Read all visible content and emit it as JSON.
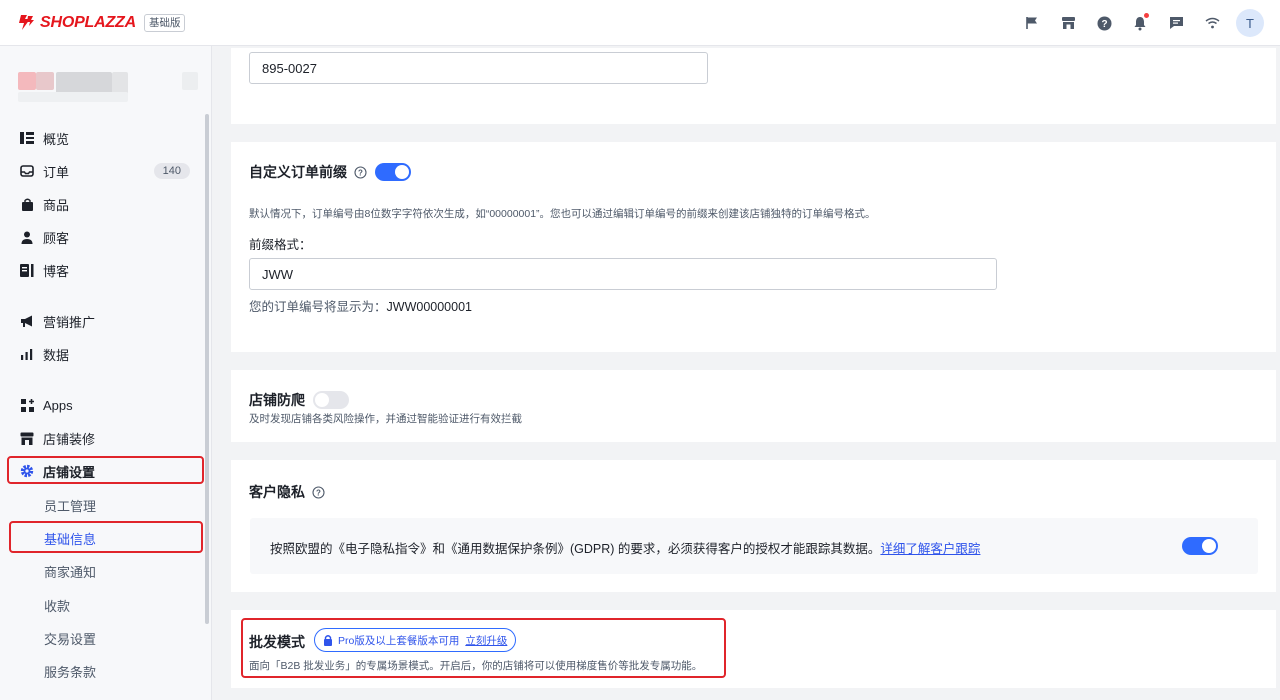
{
  "header": {
    "brand": "SHOPLAZZA",
    "plan_badge": "基础版",
    "icons": [
      "flag-icon",
      "store-icon",
      "help-icon",
      "bell-icon",
      "message-icon",
      "wifi-icon"
    ],
    "avatar_initial": "T"
  },
  "sidebar": {
    "items": [
      {
        "label": "概览",
        "icon": "overview-icon"
      },
      {
        "label": "订单",
        "icon": "inbox-icon",
        "badge": "140"
      },
      {
        "label": "商品",
        "icon": "bag-icon"
      },
      {
        "label": "顾客",
        "icon": "user-icon"
      },
      {
        "label": "博客",
        "icon": "blog-icon"
      },
      {
        "label": "营销推广",
        "icon": "megaphone-icon"
      },
      {
        "label": "数据",
        "icon": "bar-chart-icon"
      },
      {
        "label": "Apps",
        "icon": "apps-icon"
      },
      {
        "label": "店铺装修",
        "icon": "storefront-icon"
      },
      {
        "label": "店铺设置",
        "icon": "gear-icon"
      }
    ],
    "sub_items": [
      {
        "label": "员工管理"
      },
      {
        "label": "基础信息"
      },
      {
        "label": "商家通知"
      },
      {
        "label": "收款"
      },
      {
        "label": "交易设置"
      },
      {
        "label": "服务条款"
      }
    ]
  },
  "main": {
    "phone_value": "895-0027",
    "order_prefix": {
      "title": "自定义订单前缀",
      "enabled": true,
      "description": "默认情况下，订单编号由8位数字字符依次生成，如“00000001”。您也可以通过编辑订单编号的前缀来创建该店铺独特的订单编号格式。",
      "format_label": "前缀格式：",
      "format_value": "JWW",
      "preview_prefix": "您的订单编号将显示为：",
      "preview_value": "JWW00000001"
    },
    "anti_crawl": {
      "title": "店铺防爬",
      "enabled": false,
      "description": "及时发现店铺各类风险操作，并通过智能验证进行有效拦截"
    },
    "privacy": {
      "title": "客户隐私",
      "text": "按照欧盟的《电子隐私指令》和《通用数据保护条例》(GDPR) 的要求，必须获得客户的授权才能跟踪其数据。",
      "link": "详细了解客户跟踪",
      "enabled": true
    },
    "wholesale": {
      "title": "批发模式",
      "pill_text": "Pro版及以上套餐版本可用",
      "upgrade_link": "立刻升级",
      "description": "面向「B2B 批发业务」的专属场景模式。开启后，你的店铺将可以使用梯度售价等批发专属功能。"
    }
  }
}
